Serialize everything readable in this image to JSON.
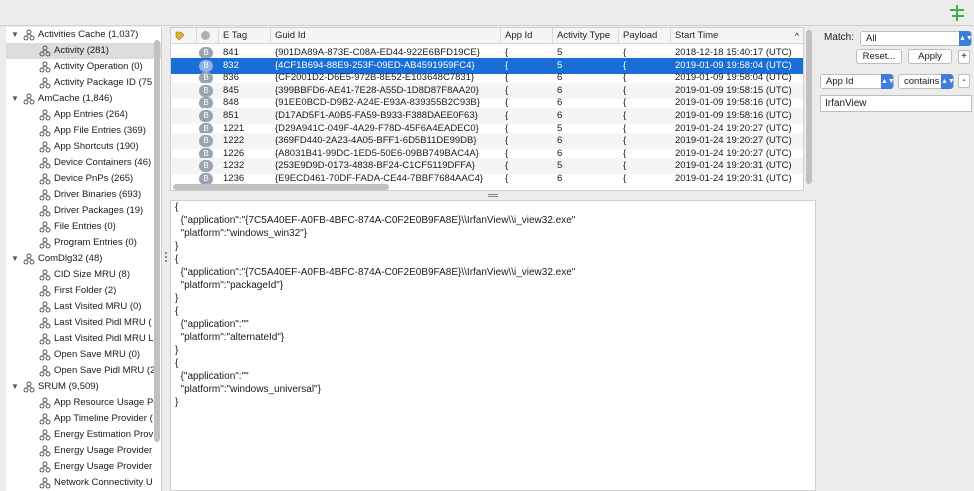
{
  "colors": {
    "selection": "#1a6ed8",
    "accent_icon": "#3cb043"
  },
  "sidebar": {
    "items": [
      {
        "label": "Activities Cache (1,037)",
        "level": 0,
        "expanded": true
      },
      {
        "label": "Activity (281)",
        "level": 1,
        "selected": true
      },
      {
        "label": "Activity Operation (0)",
        "level": 1
      },
      {
        "label": "Activity Package ID (75",
        "level": 1
      },
      {
        "label": "AmCache (1,846)",
        "level": 0,
        "expanded": true
      },
      {
        "label": "App Entries (264)",
        "level": 1
      },
      {
        "label": "App File Entries (369)",
        "level": 1
      },
      {
        "label": "App Shortcuts (190)",
        "level": 1
      },
      {
        "label": "Device Containers (46)",
        "level": 1
      },
      {
        "label": "Device PnPs (265)",
        "level": 1
      },
      {
        "label": "Driver Binaries (693)",
        "level": 1
      },
      {
        "label": "Driver Packages (19)",
        "level": 1
      },
      {
        "label": "File Entries (0)",
        "level": 1
      },
      {
        "label": "Program Entries (0)",
        "level": 1
      },
      {
        "label": "ComDlg32 (48)",
        "level": 0,
        "expanded": true
      },
      {
        "label": "CID Size MRU (8)",
        "level": 1
      },
      {
        "label": "First Folder (2)",
        "level": 1
      },
      {
        "label": "Last Visited MRU (0)",
        "level": 1
      },
      {
        "label": "Last Visited Pidl MRU (",
        "level": 1
      },
      {
        "label": "Last Visited Pidl MRU L",
        "level": 1
      },
      {
        "label": "Open Save MRU (0)",
        "level": 1
      },
      {
        "label": "Open Save Pidl MRU (2",
        "level": 1
      },
      {
        "label": "SRUM (9,509)",
        "level": 0,
        "expanded": true
      },
      {
        "label": "App Resource Usage Pr",
        "level": 1
      },
      {
        "label": "App Timeline Provider (",
        "level": 1
      },
      {
        "label": "Energy Estimation Prov",
        "level": 1
      },
      {
        "label": "Energy Usage Provider",
        "level": 1
      },
      {
        "label": "Energy Usage Provider",
        "level": 1
      },
      {
        "label": "Network Connectivity U",
        "level": 1
      }
    ]
  },
  "table": {
    "columns": [
      "E Tag",
      "Guid Id",
      "App Id",
      "Activity Type",
      "Payload",
      "Start Time"
    ],
    "badge_label": "B",
    "sort_indicator": "^",
    "rows": [
      {
        "etag": "841",
        "guid": "{901DA89A-873E-C08A-ED44-922E6BFD19CE}",
        "appid": "{",
        "type": "5",
        "payload": "{",
        "start": "2018-12-18 15:40:17 (UTC)"
      },
      {
        "etag": "832",
        "guid": "{4CF1B694-88E9-253F-09ED-AB4591959FC4}",
        "appid": "{",
        "type": "5",
        "payload": "{",
        "start": "2019-01-09 19:58:04 (UTC)",
        "selected": true
      },
      {
        "etag": "836",
        "guid": "{CF2001D2-D6E5-972B-8E52-E103648C7831}",
        "appid": "{",
        "type": "6",
        "payload": "{",
        "start": "2019-01-09 19:58:04 (UTC)"
      },
      {
        "etag": "845",
        "guid": "{399BBFD6-AE41-7E28-A55D-1D8D87F8AA20}",
        "appid": "{",
        "type": "6",
        "payload": "{",
        "start": "2019-01-09 19:58:15 (UTC)"
      },
      {
        "etag": "848",
        "guid": "{91EE0BCD-D9B2-A24E-E93A-839355B2C93B}",
        "appid": "{",
        "type": "6",
        "payload": "{",
        "start": "2019-01-09 19:58:16 (UTC)"
      },
      {
        "etag": "851",
        "guid": "{D17AD5F1-A0B5-FA59-B933-F388DAEE0F63}",
        "appid": "{",
        "type": "6",
        "payload": "{",
        "start": "2019-01-09 19:58:16 (UTC)"
      },
      {
        "etag": "1221",
        "guid": "{D29A941C-049F-4A29-F78D-45F6A4EADEC0}",
        "appid": "{",
        "type": "5",
        "payload": "{",
        "start": "2019-01-24 19:20:27 (UTC)"
      },
      {
        "etag": "1222",
        "guid": "{369FD440-2A23-4A05-BFF1-6D5B11DE99DB}",
        "appid": "{",
        "type": "6",
        "payload": "{",
        "start": "2019-01-24 19:20:27 (UTC)"
      },
      {
        "etag": "1226",
        "guid": "{A8031B41-99DC-1ED5-50E6-09BB749BAC4A}",
        "appid": "{",
        "type": "6",
        "payload": "{",
        "start": "2019-01-24 19:20:27 (UTC)"
      },
      {
        "etag": "1232",
        "guid": "{253E9D9D-0173-4838-BF24-C1CF5119DFFA}",
        "appid": "{",
        "type": "5",
        "payload": "{",
        "start": "2019-01-24 19:20:31 (UTC)"
      },
      {
        "etag": "1236",
        "guid": "{E9ECD461-70DF-FADA-CE44-7BBF7684AAC4}",
        "appid": "{",
        "type": "6",
        "payload": "{",
        "start": "2019-01-24 19:20:31 (UTC)"
      }
    ]
  },
  "json_view": {
    "lines": [
      "{",
      "  {\"application\":\"{7C5A40EF-A0FB-4BFC-874A-C0F2E0B9FA8E}\\\\IrfanView\\\\i_view32.exe\"",
      "  \"platform\":\"windows_win32\"}",
      "}",
      "{",
      "  {\"application\":\"{7C5A40EF-A0FB-4BFC-874A-C0F2E0B9FA8E}\\\\IrfanView\\\\i_view32.exe\"",
      "  \"platform\":\"packageId\"}",
      "}",
      "{",
      "  {\"application\":\"\"",
      "  \"platform\":\"alternateId\"}",
      "}",
      "{",
      "  {\"application\":\"\"",
      "  \"platform\":\"windows_universal\"}",
      "}"
    ]
  },
  "filter": {
    "match_label": "Match:",
    "match_value": "All",
    "reset_label": "Reset...",
    "apply_label": "Apply",
    "plus_label": "+",
    "minus_label": "-",
    "field_value": "App Id",
    "operator_value": "contains",
    "search_value": "IrfanView"
  }
}
